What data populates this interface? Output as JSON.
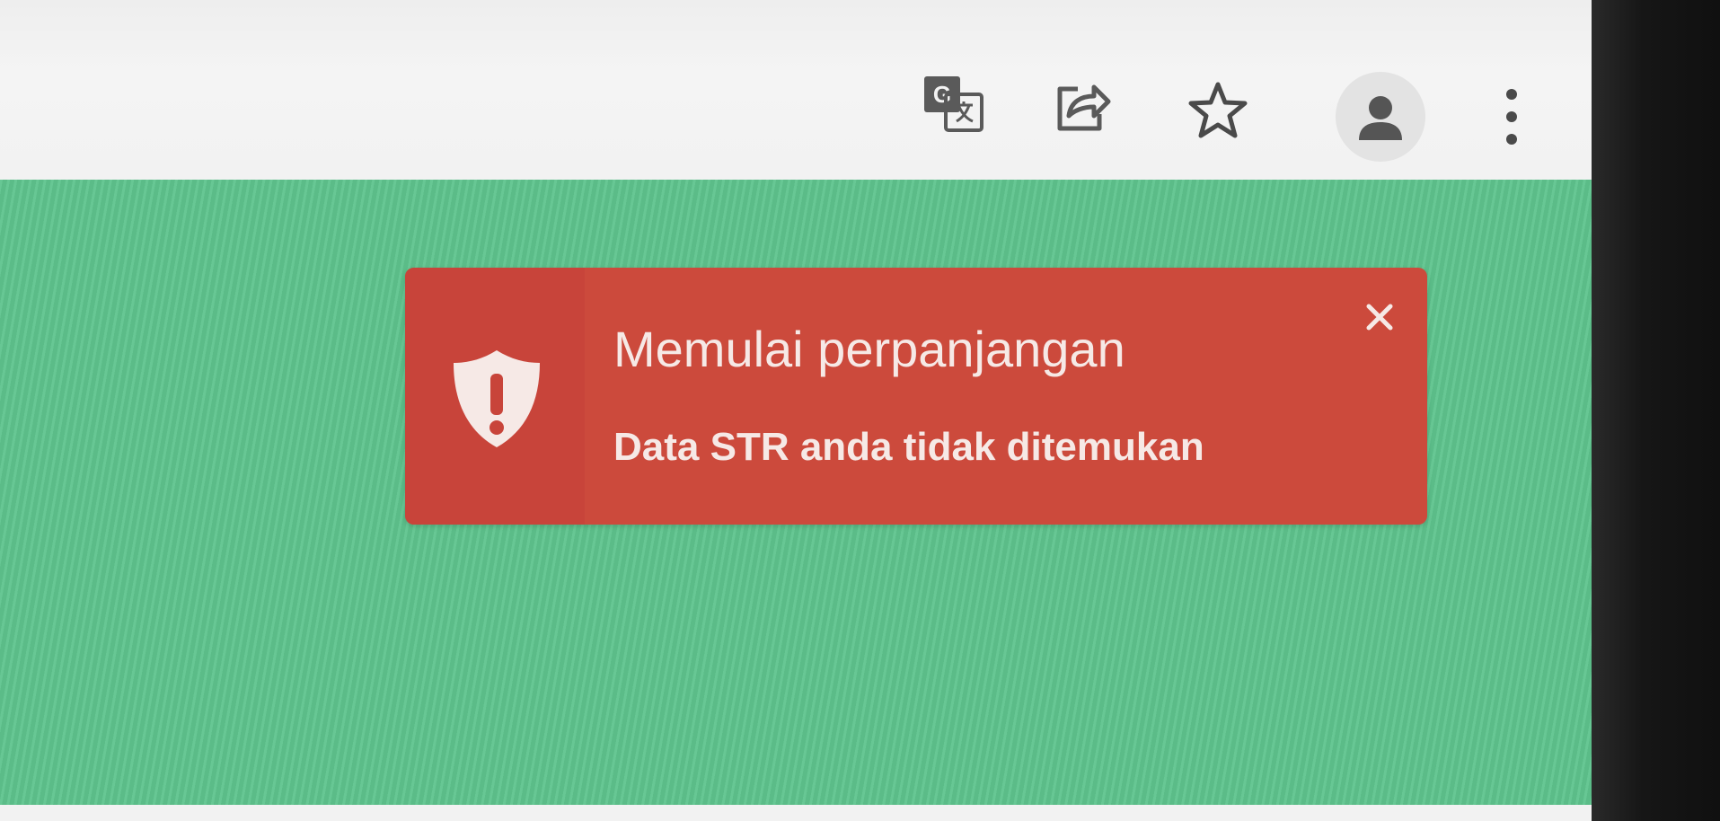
{
  "toolbar": {
    "icons": [
      "translate-icon",
      "share-icon",
      "bookmark-star-icon",
      "profile-icon",
      "menu-kebab-icon"
    ]
  },
  "colors": {
    "page_background": "#5fc48e",
    "toast_background": "#cc4a3c",
    "toast_text": "#f6e9e6",
    "toolbar_background": "#f2f2f2"
  },
  "toast": {
    "title": "Memulai perpanjangan",
    "message": "Data STR anda tidak ditemukan",
    "icon": "shield-alert-icon",
    "close_icon": "close-icon"
  }
}
